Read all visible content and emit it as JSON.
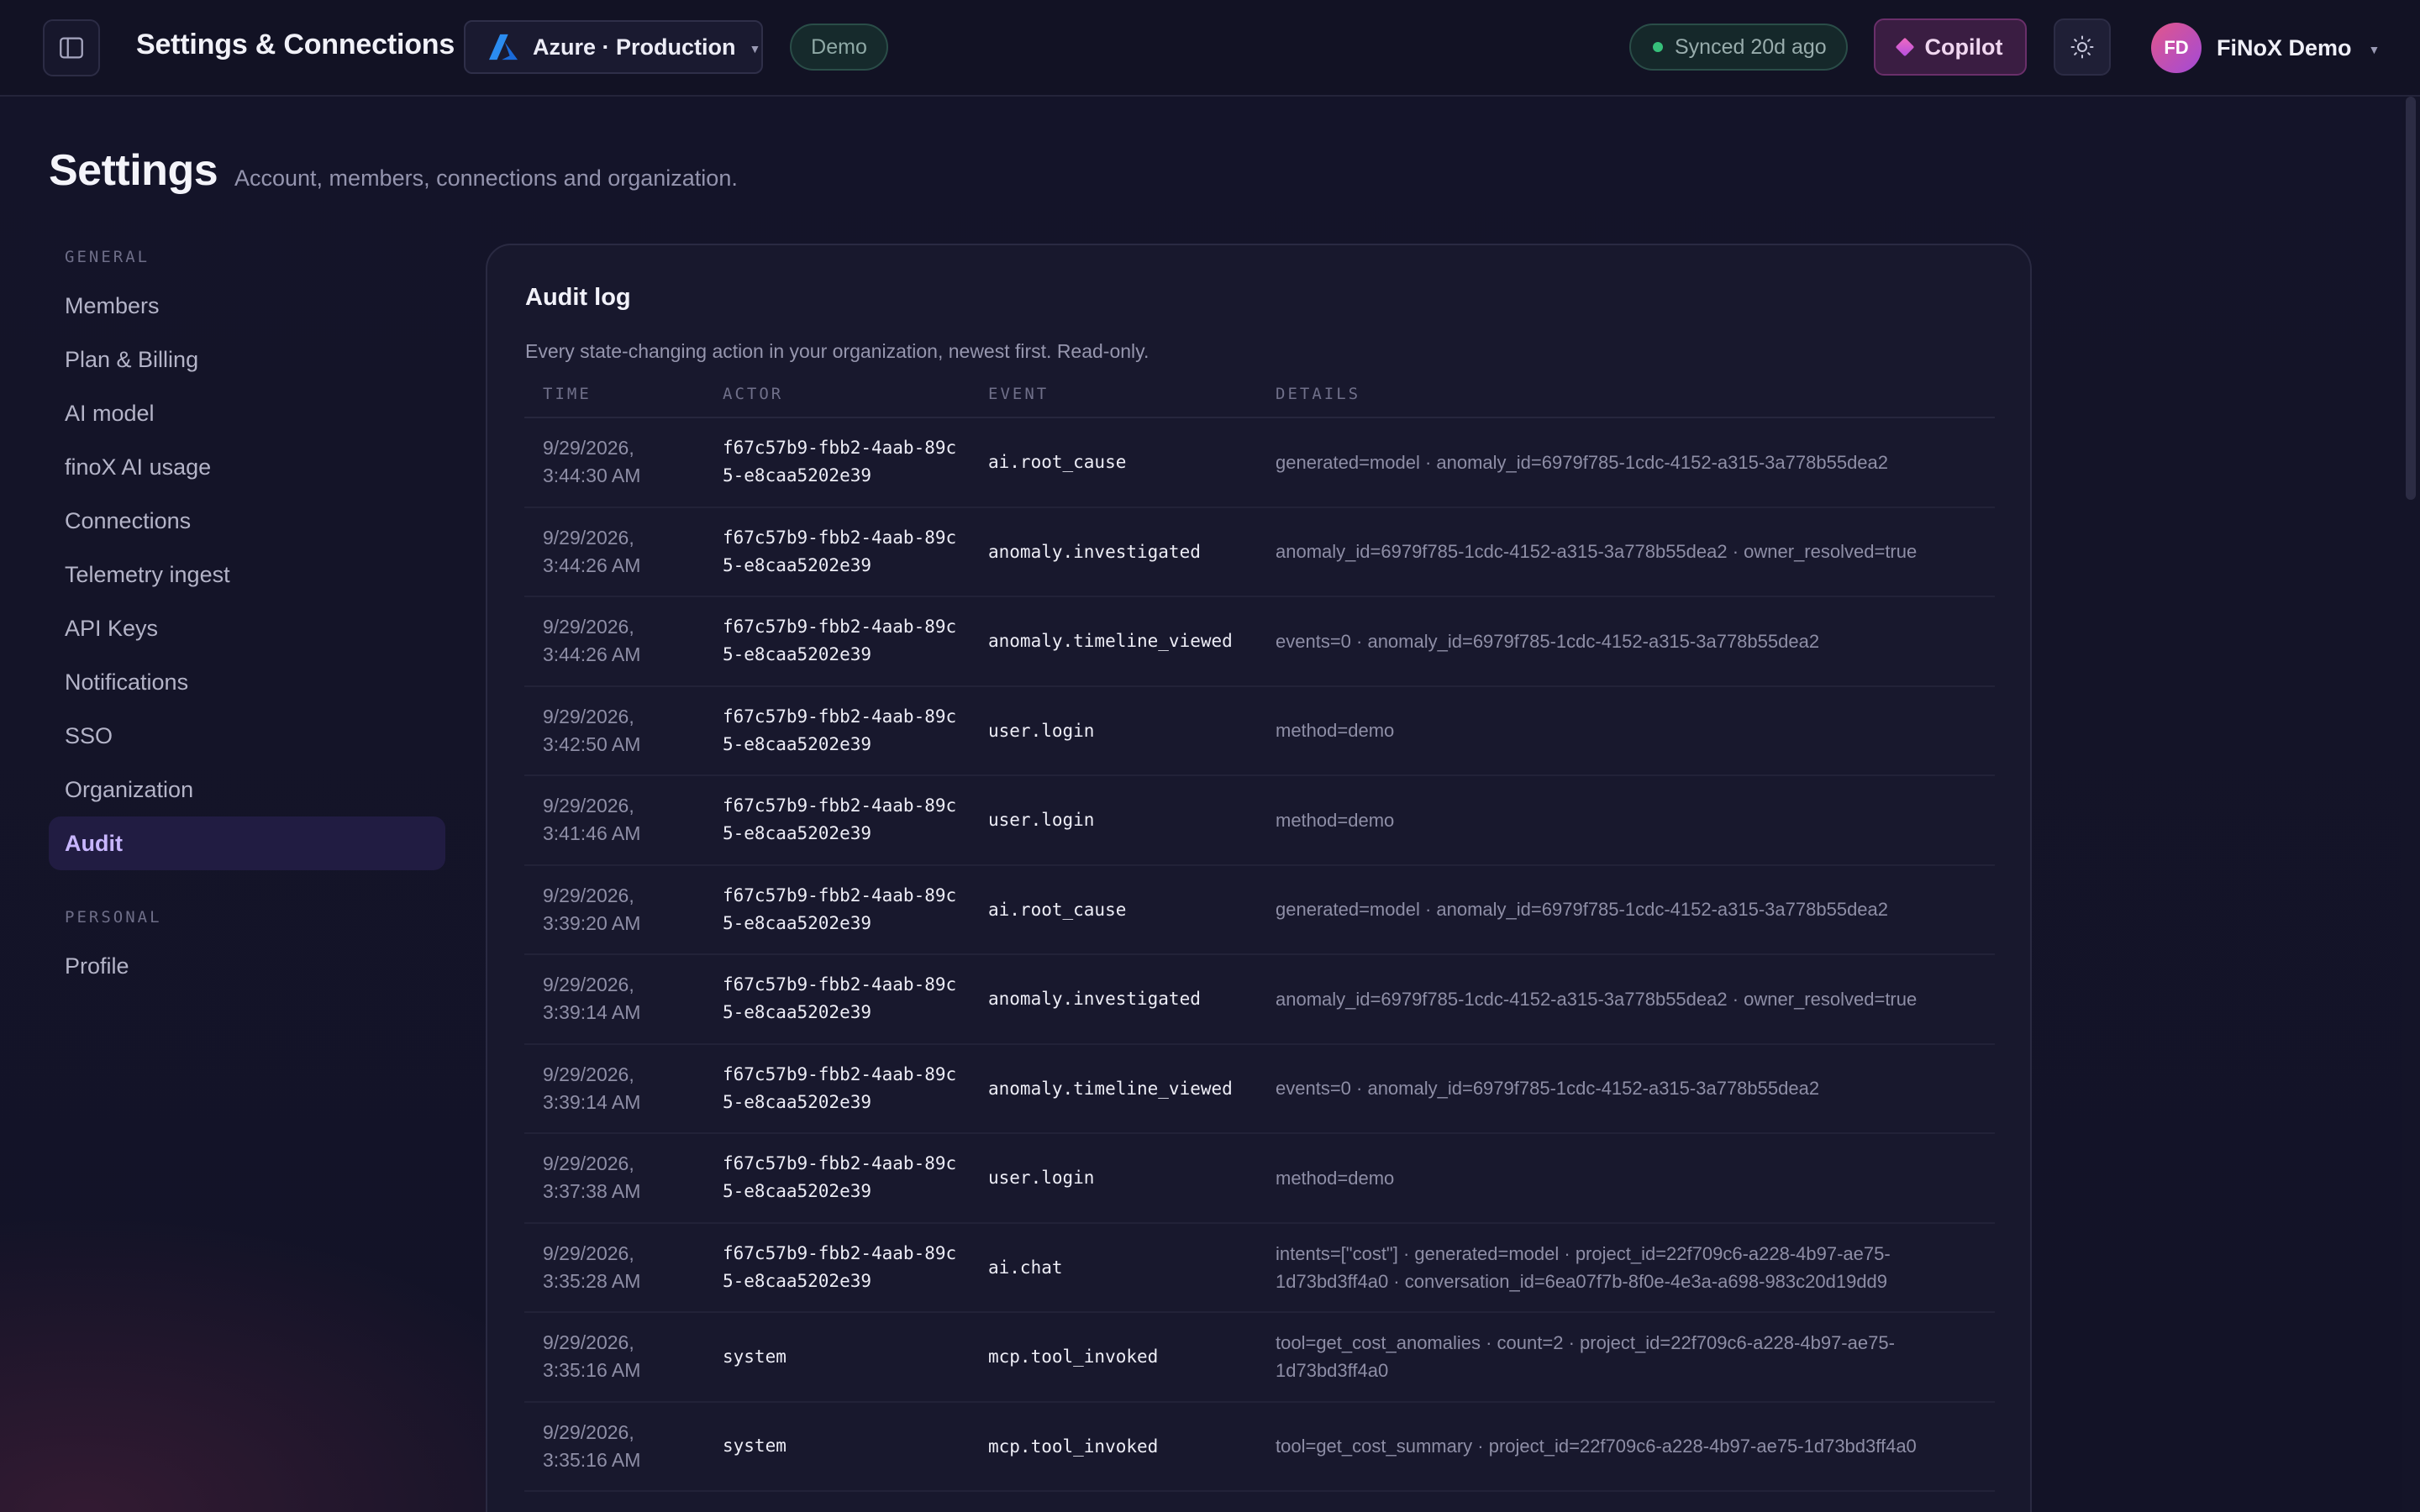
{
  "topbar": {
    "title": "Settings & Connections",
    "environment": "Azure · Production",
    "demo_badge": "Demo",
    "sync_status": "Synced 20d ago",
    "copilot_label": "Copilot",
    "user_initials": "FD",
    "user_name": "FiNoX Demo"
  },
  "page": {
    "title": "Settings",
    "subtitle": "Account, members, connections and organization."
  },
  "nav": {
    "general_label": "GENERAL",
    "general_items": [
      "Members",
      "Plan & Billing",
      "AI model",
      "finoX AI usage",
      "Connections",
      "Telemetry ingest",
      "API Keys",
      "Notifications",
      "SSO",
      "Organization",
      "Audit"
    ],
    "active_item": "Audit",
    "personal_label": "PERSONAL",
    "personal_items": [
      "Profile"
    ]
  },
  "audit": {
    "title": "Audit log",
    "description": "Every state-changing action in your organization, newest first. Read-only.",
    "columns": [
      "TIME",
      "ACTOR",
      "EVENT",
      "DETAILS"
    ],
    "rows": [
      {
        "time": "9/29/2026, 3:44:30 AM",
        "actor": "f67c57b9-fbb2-4aab-89c5-e8caa5202e39",
        "event": "ai.root_cause",
        "details": "generated=model · anomaly_id=6979f785-1cdc-4152-a315-3a778b55dea2"
      },
      {
        "time": "9/29/2026, 3:44:26 AM",
        "actor": "f67c57b9-fbb2-4aab-89c5-e8caa5202e39",
        "event": "anomaly.investigated",
        "details": "anomaly_id=6979f785-1cdc-4152-a315-3a778b55dea2 · owner_resolved=true"
      },
      {
        "time": "9/29/2026, 3:44:26 AM",
        "actor": "f67c57b9-fbb2-4aab-89c5-e8caa5202e39",
        "event": "anomaly.timeline_viewed",
        "details": "events=0 · anomaly_id=6979f785-1cdc-4152-a315-3a778b55dea2"
      },
      {
        "time": "9/29/2026, 3:42:50 AM",
        "actor": "f67c57b9-fbb2-4aab-89c5-e8caa5202e39",
        "event": "user.login",
        "details": "method=demo"
      },
      {
        "time": "9/29/2026, 3:41:46 AM",
        "actor": "f67c57b9-fbb2-4aab-89c5-e8caa5202e39",
        "event": "user.login",
        "details": "method=demo"
      },
      {
        "time": "9/29/2026, 3:39:20 AM",
        "actor": "f67c57b9-fbb2-4aab-89c5-e8caa5202e39",
        "event": "ai.root_cause",
        "details": "generated=model · anomaly_id=6979f785-1cdc-4152-a315-3a778b55dea2"
      },
      {
        "time": "9/29/2026, 3:39:14 AM",
        "actor": "f67c57b9-fbb2-4aab-89c5-e8caa5202e39",
        "event": "anomaly.investigated",
        "details": "anomaly_id=6979f785-1cdc-4152-a315-3a778b55dea2 · owner_resolved=true"
      },
      {
        "time": "9/29/2026, 3:39:14 AM",
        "actor": "f67c57b9-fbb2-4aab-89c5-e8caa5202e39",
        "event": "anomaly.timeline_viewed",
        "details": "events=0 · anomaly_id=6979f785-1cdc-4152-a315-3a778b55dea2"
      },
      {
        "time": "9/29/2026, 3:37:38 AM",
        "actor": "f67c57b9-fbb2-4aab-89c5-e8caa5202e39",
        "event": "user.login",
        "details": "method=demo"
      },
      {
        "time": "9/29/2026, 3:35:28 AM",
        "actor": "f67c57b9-fbb2-4aab-89c5-e8caa5202e39",
        "event": "ai.chat",
        "details": "intents=[\"cost\"] · generated=model · project_id=22f709c6-a228-4b97-ae75-1d73bd3ff4a0 · conversation_id=6ea07f7b-8f0e-4e3a-a698-983c20d19dd9"
      },
      {
        "time": "9/29/2026, 3:35:16 AM",
        "actor": "system",
        "event": "mcp.tool_invoked",
        "details": "tool=get_cost_anomalies · count=2 · project_id=22f709c6-a228-4b97-ae75-1d73bd3ff4a0"
      },
      {
        "time": "9/29/2026, 3:35:16 AM",
        "actor": "system",
        "event": "mcp.tool_invoked",
        "details": "tool=get_cost_summary · project_id=22f709c6-a228-4b97-ae75-1d73bd3ff4a0"
      }
    ]
  },
  "icons": {
    "sidebar_toggle": "sidebar-toggle-icon",
    "environment": "azure-icon",
    "copilot": "diamond-icon",
    "theme": "sun-icon",
    "dropdown": "chevron-down-icon"
  },
  "colors": {
    "accent": "#c8b6ff",
    "sync_dot": "#36c07a",
    "copilot_bg": "#3a1d42"
  }
}
